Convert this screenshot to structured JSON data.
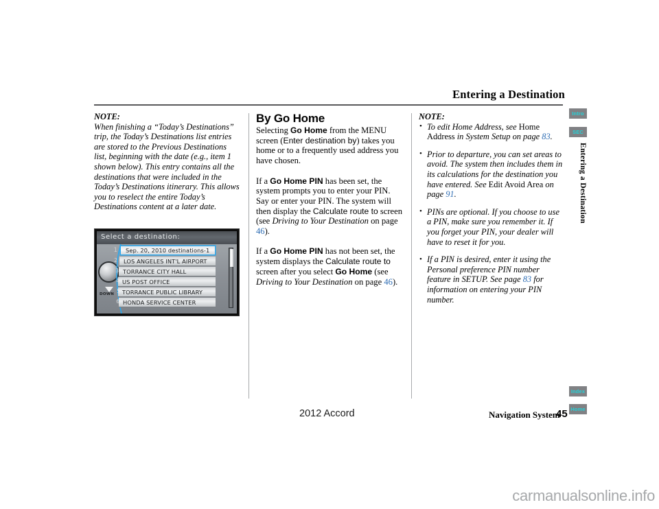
{
  "header": {
    "title": "Entering a Destination"
  },
  "left_column": {
    "note_label": "NOTE:",
    "note_body": "When finishing a “Today’s Destinations” trip, the Today’s Destinations list entries are stored to the Previous Destinations list, beginning with the date (e.g., item  1 shown below). This entry contains all the destinations that were included in the Today’s Destinations itinerary. This allows you to reselect the entire Today’s Destinations content at a later date."
  },
  "middle_column": {
    "heading": "By Go Home",
    "p1": {
      "a": "Selecting ",
      "go_home": "Go Home",
      "b": " from the MENU screen (",
      "enter_destination_by": "Enter destination by",
      "c": ") takes you home or to a frequently used address you have chosen."
    },
    "p2": {
      "a": "If a ",
      "go_home_pin": "Go Home PIN",
      "b": " has been set, the system prompts you to enter your PIN. Say or enter your PIN. The system will then display the ",
      "calculate_route": "Calculate route to",
      "c": " screen (see ",
      "ref_title": "Driving to Your Destination",
      "d": " on page ",
      "page": "46",
      "e": ")."
    },
    "p3": {
      "a": "If a ",
      "go_home_pin": "Go Home PIN",
      "b": " has not been set, the system displays the ",
      "calculate_route": "Calculate route to",
      "c": " screen after you select ",
      "go_home": "Go Home",
      "d": " (see ",
      "ref_title": "Driving to Your Destination",
      "e": " on page ",
      "page": "46",
      "f": ")."
    }
  },
  "right_column": {
    "note_label": "NOTE:",
    "bullets": [
      {
        "a": "To edit Home Address, see ",
        "roman": "Home Address",
        "b": " in System Setup on page ",
        "page": "83",
        "c": "."
      },
      {
        "a": "Prior to departure, you can set areas to avoid. The system then includes them in its calculations for the destination you have entered. See ",
        "roman": "Edit Avoid Area",
        "b": " on page ",
        "page": "91",
        "c": "."
      },
      {
        "a": "PINs are optional. If you choose to use a PIN, make sure you remember it. If you forget your PIN, your dealer will have to reset it for you.",
        "roman": "",
        "b": "",
        "page": "",
        "c": ""
      },
      {
        "a": "If a PIN is desired, enter it using the Personal preference PIN number feature in SETUP. See page ",
        "roman": "",
        "b": "",
        "page": "83",
        "c": " for information on entering your PIN number."
      }
    ]
  },
  "nav_screen": {
    "title": "Select a destination:",
    "down_label": "DOWN",
    "rows": [
      {
        "num": "1",
        "text": "Sep. 20, 2010 destinations-1",
        "selected": true
      },
      {
        "num": "2",
        "text": "LOS ANGELES INT'L AIRPORT",
        "selected": false
      },
      {
        "num": "3",
        "text": "TORRANCE CITY HALL",
        "selected": false
      },
      {
        "num": "4",
        "text": "US POST OFFICE",
        "selected": false
      },
      {
        "num": "5",
        "text": "TORRANCE PUBLIC LIBRARY",
        "selected": false
      },
      {
        "num": "6",
        "text": "HONDA SERVICE CENTER",
        "selected": false
      }
    ]
  },
  "side_tabs": {
    "intro": "Intro",
    "sec": "SEC",
    "index": "Index",
    "home": "Home",
    "vertical_label": "Entering a Destination",
    "tab_bg": "#808184",
    "tab_fg": "#22d3d9"
  },
  "footer": {
    "model": "2012 Accord",
    "system": "Navigation System",
    "page_number": "45"
  },
  "watermark": "carmanualsonline.info"
}
